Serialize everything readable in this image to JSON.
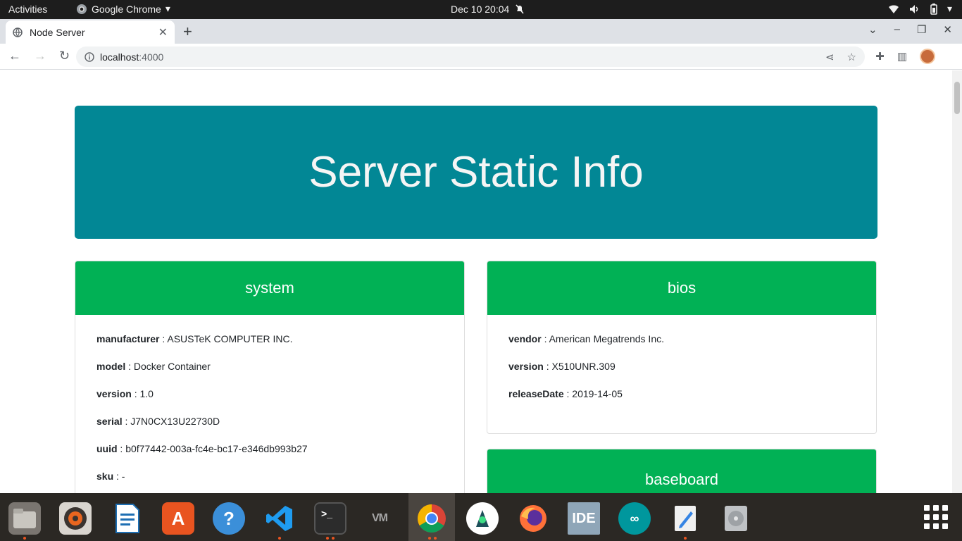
{
  "topbar": {
    "activities": "Activities",
    "app_name": "Google Chrome",
    "clock": "Dec 10  20:04"
  },
  "browser": {
    "tab_title": "Node Server",
    "url_host": "localhost",
    "url_port": ":4000"
  },
  "page": {
    "heading": "Server Static Info",
    "cards": {
      "system": {
        "title": "system",
        "rows": [
          {
            "key": "manufacturer",
            "value": " : ASUSTeK COMPUTER INC."
          },
          {
            "key": "model",
            "value": " : Docker Container"
          },
          {
            "key": "version",
            "value": " : 1.0"
          },
          {
            "key": "serial",
            "value": " : J7N0CX13U22730D"
          },
          {
            "key": "uuid",
            "value": " : b0f77442-003a-fc4e-bc17-e346db993b27"
          },
          {
            "key": "sku",
            "value": " : -"
          }
        ]
      },
      "bios": {
        "title": "bios",
        "rows": [
          {
            "key": "vendor",
            "value": " : American Megatrends Inc."
          },
          {
            "key": "version",
            "value": " : X510UNR.309"
          },
          {
            "key": "releaseDate",
            "value": " : 2019-14-05"
          }
        ]
      },
      "baseboard": {
        "title": "baseboard"
      }
    }
  },
  "colors": {
    "jumbotron": "#028795",
    "card_header": "#01b155",
    "dock": "#2b2824",
    "top_bar": "#1d1d1d"
  },
  "dock": {
    "items": [
      {
        "icon": "files-icon",
        "label": ""
      },
      {
        "icon": "rhythmbox-icon",
        "label": ""
      },
      {
        "icon": "libreoffice-writer-icon",
        "label": ""
      },
      {
        "icon": "software-center-icon",
        "label": ""
      },
      {
        "icon": "help-icon",
        "label": ""
      },
      {
        "icon": "vscode-icon",
        "label": ""
      },
      {
        "icon": "terminal-icon",
        "label": ""
      },
      {
        "icon": "vm-icon",
        "label": ""
      },
      {
        "icon": "chrome-icon",
        "label": ""
      },
      {
        "icon": "android-studio-icon",
        "label": ""
      },
      {
        "icon": "firefox-icon",
        "label": ""
      },
      {
        "icon": "intellij-icon",
        "label": "IDE"
      },
      {
        "icon": "arduino-icon",
        "label": ""
      },
      {
        "icon": "text-editor-icon",
        "label": ""
      },
      {
        "icon": "disk-icon",
        "label": ""
      }
    ]
  }
}
